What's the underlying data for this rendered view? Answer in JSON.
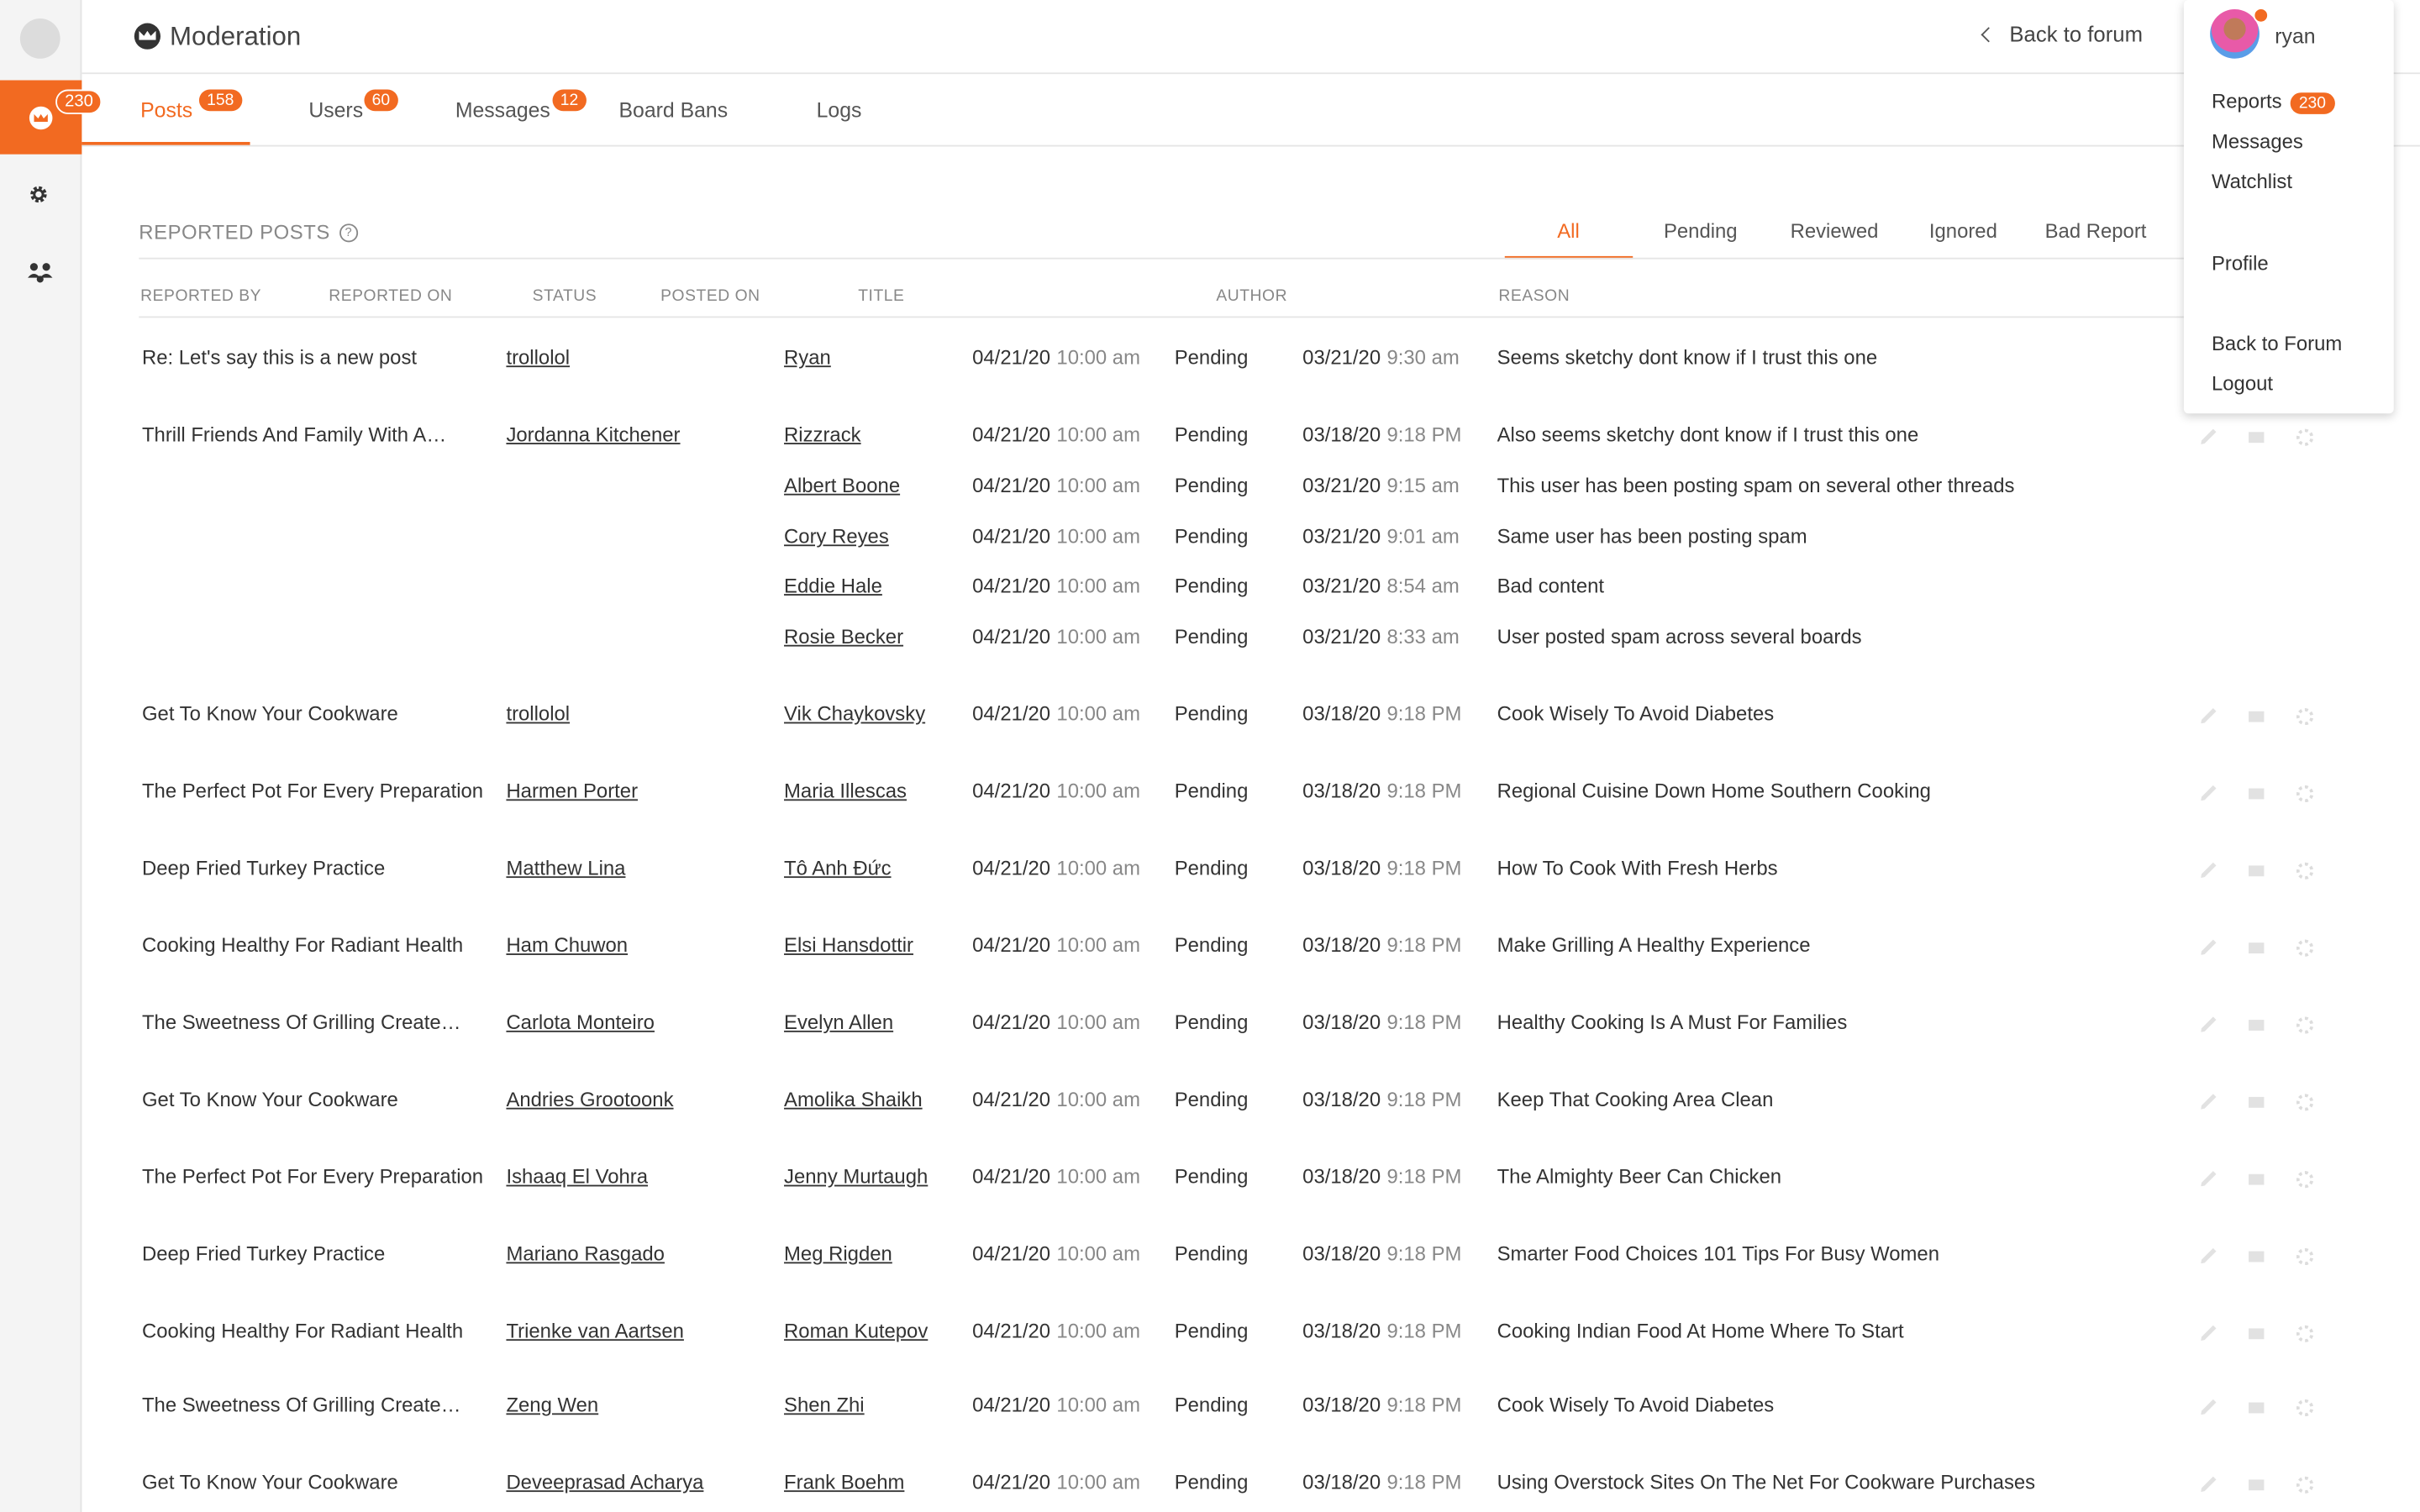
{
  "app": {
    "title": "Moderation",
    "back_label": "Back to forum"
  },
  "rail": {
    "reports_count": "230"
  },
  "tabs": [
    {
      "label": "Posts",
      "badge": "158"
    },
    {
      "label": "Users",
      "badge": "60"
    },
    {
      "label": "Messages",
      "badge": "12"
    },
    {
      "label": "Board Bans",
      "badge": ""
    },
    {
      "label": "Logs",
      "badge": ""
    }
  ],
  "section": {
    "title": "REPORTED POSTS",
    "help": "?"
  },
  "filters": [
    "All",
    "Pending",
    "Reviewed",
    "Ignored",
    "Bad Report"
  ],
  "columns": [
    "REPORTED BY",
    "REPORTED ON",
    "STATUS",
    "POSTED ON",
    "TITLE",
    "AUTHOR",
    "REASON"
  ],
  "rows": [
    {
      "title": "Re: Let's say this is a new post",
      "author": "trollolol",
      "reporter": "Ryan",
      "reported_date": "04/21/20",
      "reported_time": "10:00 am",
      "status": "Pending",
      "posted_date": "03/21/20",
      "posted_time": "9:30 am",
      "reason": "Seems sketchy dont know if I trust this one",
      "actions": false
    },
    {
      "title": "Thrill Friends And Family With A…",
      "author": "Jordanna Kitchener",
      "reporter": "Rizzrack",
      "reported_date": "04/21/20",
      "reported_time": "10:00 am",
      "status": "Pending",
      "posted_date": "03/18/20",
      "posted_time": "9:18 PM",
      "reason": "Also seems sketchy dont know if I trust this one",
      "actions": true
    },
    {
      "title": "",
      "author": "",
      "reporter": "Albert Boone",
      "reported_date": "04/21/20",
      "reported_time": "10:00 am",
      "status": "Pending",
      "posted_date": "03/21/20",
      "posted_time": "9:15 am",
      "reason": "This user has been posting spam on several other threads",
      "actions": false
    },
    {
      "title": "",
      "author": "",
      "reporter": "Cory Reyes",
      "reported_date": "04/21/20",
      "reported_time": "10:00 am",
      "status": "Pending",
      "posted_date": "03/21/20",
      "posted_time": "9:01 am",
      "reason": "Same user has been posting spam",
      "actions": false
    },
    {
      "title": "",
      "author": "",
      "reporter": "Eddie Hale",
      "reported_date": "04/21/20",
      "reported_time": "10:00 am",
      "status": "Pending",
      "posted_date": "03/21/20",
      "posted_time": "8:54 am",
      "reason": "Bad content",
      "actions": false
    },
    {
      "title": "",
      "author": "",
      "reporter": "Rosie Becker",
      "reported_date": "04/21/20",
      "reported_time": "10:00 am",
      "status": "Pending",
      "posted_date": "03/21/20",
      "posted_time": "8:33 am",
      "reason": "User posted spam across several boards",
      "actions": false
    },
    {
      "title": "Get To Know Your Cookware",
      "author": "trollolol",
      "reporter": "Vik Chaykovsky",
      "reported_date": "04/21/20",
      "reported_time": "10:00 am",
      "status": "Pending",
      "posted_date": "03/18/20",
      "posted_time": "9:18 PM",
      "reason": "Cook Wisely To Avoid Diabetes",
      "actions": true
    },
    {
      "title": "The Perfect Pot For Every Preparation",
      "author": "Harmen Porter",
      "reporter": "Maria Illescas",
      "reported_date": "04/21/20",
      "reported_time": "10:00 am",
      "status": "Pending",
      "posted_date": "03/18/20",
      "posted_time": "9:18 PM",
      "reason": "Regional Cuisine Down Home Southern Cooking",
      "actions": true
    },
    {
      "title": "Deep Fried Turkey Practice",
      "author": "Matthew Lina",
      "reporter": "Tô Anh Đức",
      "reported_date": "04/21/20",
      "reported_time": "10:00 am",
      "status": "Pending",
      "posted_date": "03/18/20",
      "posted_time": "9:18 PM",
      "reason": "How To Cook With Fresh Herbs",
      "actions": true
    },
    {
      "title": "Cooking Healthy For Radiant Health",
      "author": "Ham Chuwon",
      "reporter": "Elsi Hansdottir",
      "reported_date": "04/21/20",
      "reported_time": "10:00 am",
      "status": "Pending",
      "posted_date": "03/18/20",
      "posted_time": "9:18 PM",
      "reason": "Make Grilling A Healthy Experience",
      "actions": true
    },
    {
      "title": "The Sweetness Of Grilling Create…",
      "author": "Carlota Monteiro",
      "reporter": "Evelyn Allen",
      "reported_date": "04/21/20",
      "reported_time": "10:00 am",
      "status": "Pending",
      "posted_date": "03/18/20",
      "posted_time": "9:18 PM",
      "reason": "Healthy Cooking Is A Must For Families",
      "actions": true
    },
    {
      "title": "Get To Know Your Cookware",
      "author": "Andries Grootoonk",
      "reporter": "Amolika Shaikh",
      "reported_date": "04/21/20",
      "reported_time": "10:00 am",
      "status": "Pending",
      "posted_date": "03/18/20",
      "posted_time": "9:18 PM",
      "reason": "Keep That Cooking Area Clean",
      "actions": true
    },
    {
      "title": "The Perfect Pot For Every Preparation",
      "author": "Ishaaq El Vohra",
      "reporter": "Jenny Murtaugh",
      "reported_date": "04/21/20",
      "reported_time": "10:00 am",
      "status": "Pending",
      "posted_date": "03/18/20",
      "posted_time": "9:18 PM",
      "reason": "The Almighty Beer Can Chicken",
      "actions": true
    },
    {
      "title": "Deep Fried Turkey Practice",
      "author": "Mariano Rasgado",
      "reporter": "Meg Rigden",
      "reported_date": "04/21/20",
      "reported_time": "10:00 am",
      "status": "Pending",
      "posted_date": "03/18/20",
      "posted_time": "9:18 PM",
      "reason": "Smarter Food Choices 101 Tips For Busy Women",
      "actions": true
    },
    {
      "title": "Cooking Healthy For Radiant Health",
      "author": "Trienke van Aartsen",
      "reporter": "Roman Kutepov",
      "reported_date": "04/21/20",
      "reported_time": "10:00 am",
      "status": "Pending",
      "posted_date": "03/18/20",
      "posted_time": "9:18 PM",
      "reason": "Cooking Indian Food At Home Where To Start",
      "actions": true
    },
    {
      "title": "The Sweetness Of Grilling Create…",
      "author": "Zeng Wen",
      "reporter": "Shen Zhi",
      "reported_date": "04/21/20",
      "reported_time": "10:00 am",
      "status": "Pending",
      "posted_date": "03/18/20",
      "posted_time": "9:18 PM",
      "reason": "Cook Wisely To Avoid Diabetes",
      "actions": true
    },
    {
      "title": "Get To Know Your Cookware",
      "author": "Deveeprasad Acharya",
      "reporter": "Frank Boehm",
      "reported_date": "04/21/20",
      "reported_time": "10:00 am",
      "status": "Pending",
      "posted_date": "03/18/20",
      "posted_time": "9:18 PM",
      "reason": "Using Overstock Sites On The Net For Cookware Purchases",
      "actions": true
    }
  ],
  "user_menu": {
    "username": "ryan",
    "items": [
      {
        "label": "Reports",
        "badge": "230"
      },
      {
        "label": "Messages",
        "badge": ""
      },
      {
        "label": "Watchlist",
        "badge": ""
      },
      {
        "label": "Profile",
        "badge": ""
      },
      {
        "label": "Back to Forum",
        "badge": ""
      },
      {
        "label": "Logout",
        "badge": ""
      }
    ]
  },
  "colors": {
    "accent": "#f26a21",
    "text": "#333333",
    "muted": "#888888"
  },
  "icons": [
    "crown-icon",
    "gear-icon",
    "people-icon",
    "chevron-left-icon",
    "help-icon",
    "pencil-icon",
    "mail-icon",
    "cog-icon"
  ]
}
